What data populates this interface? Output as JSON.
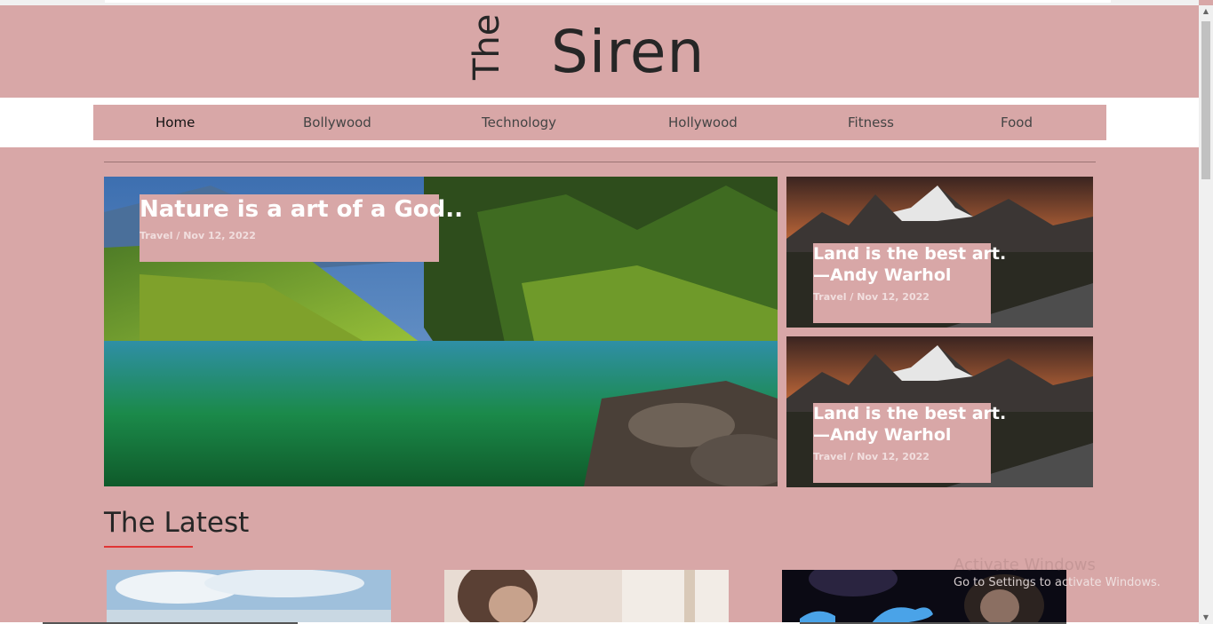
{
  "site": {
    "logo_small": "The",
    "logo_main": "Siren"
  },
  "nav": {
    "items": [
      {
        "label": "Home"
      },
      {
        "label": "Bollywood"
      },
      {
        "label": "Technology"
      },
      {
        "label": "Hollywood"
      },
      {
        "label": "Fitness"
      },
      {
        "label": "Food"
      }
    ]
  },
  "featured": {
    "main": {
      "title": "Nature is a art of a God..",
      "meta": "Travel / Nov 12, 2022",
      "image": "lake-forest-image"
    },
    "side": [
      {
        "title_line1": "Land is the best art.",
        "title_line2": "—Andy Warhol",
        "meta": "Travel / Nov 12, 2022",
        "image": "mountain-sunset-image"
      },
      {
        "title_line1": "Land is the best art.",
        "title_line2": "—Andy Warhol",
        "meta": "Travel / Nov 12, 2022",
        "image": "mountain-sunset-image"
      }
    ]
  },
  "latest": {
    "heading": "The Latest",
    "thumbs": [
      {
        "image": "sky-clouds-image"
      },
      {
        "image": "woman-portrait-image"
      },
      {
        "image": "twitter-bird-image"
      }
    ]
  },
  "watermark": {
    "title": "Activate Windows",
    "subtitle": "Go to Settings to activate Windows."
  },
  "colors": {
    "page_bg": "#d8a7a7",
    "nav_band": "#ffffff",
    "accent_underline": "#e03434",
    "text_dark": "#262626"
  }
}
